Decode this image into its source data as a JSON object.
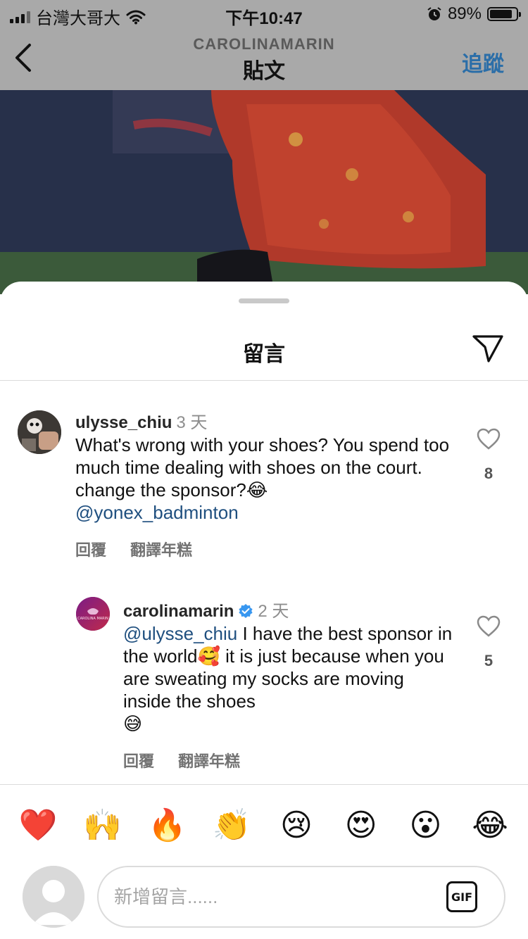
{
  "status_bar": {
    "carrier": "台灣大哥大",
    "time": "下午10:47",
    "battery": "89%",
    "battery_level": 0.89
  },
  "header": {
    "account": "CAROLINAMARIN",
    "title": "貼文",
    "follow_label": "追蹤"
  },
  "sheet": {
    "title": "留言"
  },
  "comments": [
    {
      "username": "ulysse_chiu",
      "time": "3 天",
      "text": "What's wrong with your shoes? You spend too much time dealing with shoes on the court. change the sponsor?",
      "emoji": "😂",
      "mention": "@yonex_badminton",
      "likes": "8",
      "reply_label": "回覆",
      "translate_label": "翻譯年糕"
    },
    {
      "username": "carolinamarin",
      "verified": true,
      "time": "2 天",
      "mention": "@ulysse_chiu",
      "text_1": " I have the best sponsor in the world",
      "emoji_1": "🥰",
      "text_2": " it is just because when you are sweating my socks are moving inside the shoes",
      "emoji_2": "😅",
      "likes": "5",
      "reply_label": "回覆",
      "translate_label": "翻譯年糕",
      "avatar_text": "CAROLINA MARIN"
    }
  ],
  "emoji_bar": [
    "❤️",
    "🙌",
    "🔥",
    "👏",
    "😢",
    "😍",
    "😮",
    "😂"
  ],
  "composer": {
    "placeholder": "新增留言......",
    "gif_label": "GIF"
  },
  "colors": {
    "link": "#1f4f7f",
    "follow": "#2b6ea8",
    "verified": "#3897f0"
  }
}
